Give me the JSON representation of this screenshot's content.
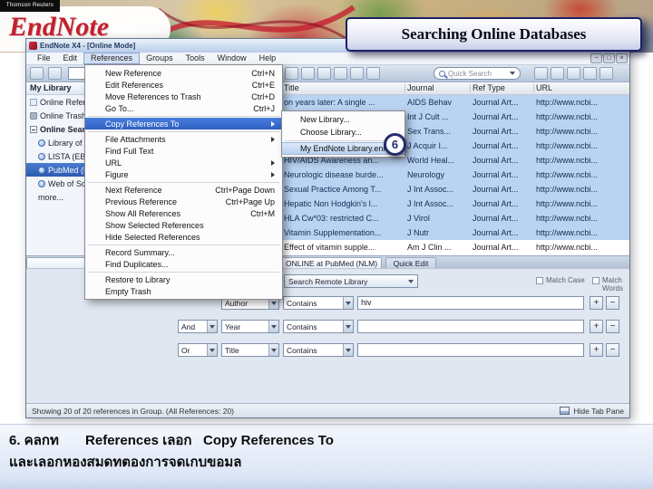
{
  "branding": {
    "thomson": "Thomson Reuters",
    "endnote": "EndNote"
  },
  "slide": {
    "title": "Searching Online Databases",
    "badge": "6",
    "caption_line1": "6. คลกท       References เลอก   Copy References To",
    "caption_line2": "และเลอกหองสมดทตองการจดเกบขอมล"
  },
  "window": {
    "title": "EndNote X4 - [Online Mode]",
    "controls": {
      "minimize": "−",
      "maximize": "□",
      "close": "×"
    },
    "menubar": {
      "items": [
        "File",
        "Edit",
        "References",
        "Groups",
        "Tools",
        "Window",
        "Help"
      ]
    },
    "toolbar": {
      "style_value": "",
      "quick_search": "Quick Search"
    },
    "sidebar": {
      "header": "My Library",
      "items": [
        {
          "label": "Online References"
        },
        {
          "label": "Online Trash"
        },
        {
          "label": "Online Search"
        },
        {
          "label": "Library of Congress"
        },
        {
          "label": "LISTA (EBSCO)"
        },
        {
          "label": "PubMed (NLM)"
        },
        {
          "label": "Web of Science"
        },
        {
          "label": "more..."
        }
      ]
    },
    "table": {
      "columns": {
        "title": "Title",
        "journal": "Journal",
        "ref_type": "Ref Type",
        "url": "URL"
      },
      "rows": [
        {
          "title": "on years later: A single ...",
          "journal": "AIDS Behav",
          "ref_type": "Journal Art...",
          "url": "http://www.ncbi..."
        },
        {
          "title": "",
          "journal": "Int J Cult ...",
          "ref_type": "Journal Art...",
          "url": "http://www.ncbi..."
        },
        {
          "title": "",
          "journal": "Sex Trans...",
          "ref_type": "Journal Art...",
          "url": "http://www.ncbi..."
        },
        {
          "title": "",
          "journal": "J Acquir I...",
          "ref_type": "Journal Art...",
          "url": "http://www.ncbi..."
        },
        {
          "title": "HIV/AIDS Awareness an...",
          "journal": "World Heal...",
          "ref_type": "Journal Art...",
          "url": "http://www.ncbi..."
        },
        {
          "title": "Neurologic disease burde...",
          "journal": "Neurology",
          "ref_type": "Journal Art...",
          "url": "http://www.ncbi..."
        },
        {
          "title": "Sexual Practice Among T...",
          "journal": "J Int Assoc...",
          "ref_type": "Journal Art...",
          "url": "http://www.ncbi..."
        },
        {
          "title": "Hepatic Non Hodgkin's l...",
          "journal": "J Int Assoc...",
          "ref_type": "Journal Art...",
          "url": "http://www.ncbi..."
        },
        {
          "title": "HLA Cw*03: restricted C...",
          "journal": "J Virol",
          "ref_type": "Journal Art...",
          "url": "http://www.ncbi..."
        },
        {
          "title": "Vitamin Supplementation...",
          "journal": "J Nutr",
          "ref_type": "Journal Art...",
          "url": "http://www.ncbi..."
        },
        {
          "title": "Effect of vitamin supple...",
          "journal": "Am J Clin ...",
          "ref_type": "Journal Art...",
          "url": "http://www.ncbi..."
        }
      ]
    },
    "references_menu": {
      "items": [
        {
          "label": "New Reference",
          "shortcut": "Ctrl+N"
        },
        {
          "label": "Edit References",
          "shortcut": "Ctrl+E"
        },
        {
          "label": "Move References to Trash",
          "shortcut": "Ctrl+D"
        },
        {
          "label": "Go To...",
          "shortcut": "Ctrl+J"
        },
        {
          "label": "Copy References To",
          "shortcut": ""
        },
        {
          "label": "File Attachments",
          "shortcut": ""
        },
        {
          "label": "Find Full Text",
          "shortcut": ""
        },
        {
          "label": "URL",
          "shortcut": ""
        },
        {
          "label": "Figure",
          "shortcut": ""
        },
        {
          "label": "Next Reference",
          "shortcut": "Ctrl+Page Down"
        },
        {
          "label": "Previous Reference",
          "shortcut": "Ctrl+Page Up"
        },
        {
          "label": "Show All References",
          "shortcut": "Ctrl+M"
        },
        {
          "label": "Show Selected References",
          "shortcut": ""
        },
        {
          "label": "Hide Selected References",
          "shortcut": ""
        },
        {
          "label": "Record Summary...",
          "shortcut": ""
        },
        {
          "label": "Find Duplicates...",
          "shortcut": ""
        },
        {
          "label": "Restore to Library",
          "shortcut": ""
        },
        {
          "label": "Empty Trash",
          "shortcut": ""
        }
      ]
    },
    "copy_submenu": {
      "items": [
        {
          "label": "New Library..."
        },
        {
          "label": "Choose Library..."
        },
        {
          "label": "My EndNote Library.enl"
        }
      ]
    },
    "bottom_tabs": {
      "active": "ONLINE at PubMed (NLM)",
      "second": "Quick Edit"
    },
    "search_panel": {
      "library_selector": "Search Remote Library",
      "match_case": "Match Case",
      "match_words": "Match Words",
      "add_label": "+",
      "remove_label": "−",
      "rows": [
        {
          "bool": "",
          "field": "Author",
          "comparator": "Contains",
          "term": "hiv"
        },
        {
          "bool": "And",
          "field": "Year",
          "comparator": "Contains",
          "term": ""
        },
        {
          "bool": "Or",
          "field": "Title",
          "comparator": "Contains",
          "term": ""
        }
      ]
    },
    "statusbar": {
      "left": "Showing 20 of 20 references in Group. (All References: 20)",
      "right": "Hide Tab Pane"
    }
  }
}
